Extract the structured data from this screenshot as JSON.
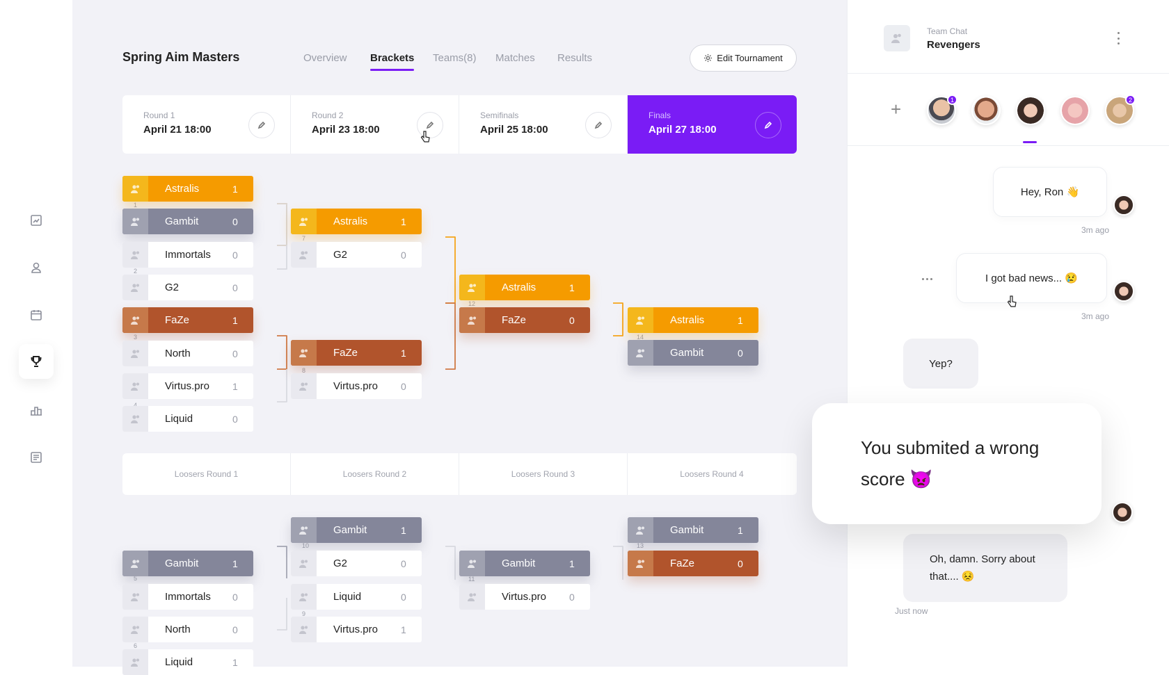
{
  "nav": {
    "items": [
      "stats",
      "profile",
      "calendar",
      "tournaments",
      "leaderboard",
      "reports"
    ],
    "active": "tournaments"
  },
  "header": {
    "title": "Spring Aim Masters",
    "tabs": [
      {
        "label": "Overview",
        "active": false
      },
      {
        "label": "Brackets",
        "active": true
      },
      {
        "label": "Teams(8)",
        "active": false
      },
      {
        "label": "Matches",
        "active": false
      },
      {
        "label": "Results",
        "active": false
      }
    ],
    "edit_button": "Edit Tournament"
  },
  "rounds": [
    {
      "label": "Round 1",
      "date": "April 21 18:00"
    },
    {
      "label": "Round 2",
      "date": "April 23 18:00"
    },
    {
      "label": "Semifinals",
      "date": "April 25 18:00"
    },
    {
      "label": "Finals",
      "date": "April 27 18:00"
    }
  ],
  "losers_rounds": [
    "Loosers Round 1",
    "Loosers Round 2",
    "Loosers Round 3",
    "Loosers Round 4"
  ],
  "bracket": {
    "r1": [
      {
        "team": "Astralis",
        "score": "1",
        "style": "orange"
      },
      {
        "team": "Gambit",
        "score": "0",
        "style": "grey"
      },
      {
        "team": "Immortals",
        "score": "0",
        "style": "white"
      },
      {
        "team": "G2",
        "score": "0",
        "style": "white"
      },
      {
        "team": "FaZe",
        "score": "1",
        "style": "brown"
      },
      {
        "team": "North",
        "score": "0",
        "style": "white"
      },
      {
        "team": "Virtus.pro",
        "score": "1",
        "style": "white"
      },
      {
        "team": "Liquid",
        "score": "0",
        "style": "white"
      }
    ],
    "r2": [
      {
        "team": "Astralis",
        "score": "1",
        "style": "orange"
      },
      {
        "team": "G2",
        "score": "0",
        "style": "white"
      },
      {
        "team": "FaZe",
        "score": "1",
        "style": "brown"
      },
      {
        "team": "Virtus.pro",
        "score": "0",
        "style": "white"
      }
    ],
    "semi": [
      {
        "team": "Astralis",
        "score": "1",
        "style": "orange"
      },
      {
        "team": "FaZe",
        "score": "0",
        "style": "brown"
      }
    ],
    "final": [
      {
        "team": "Astralis",
        "score": "1",
        "style": "orange"
      },
      {
        "team": "Gambit",
        "score": "0",
        "style": "grey"
      }
    ],
    "l1": [
      {
        "team": "Gambit",
        "score": "1",
        "style": "grey"
      },
      {
        "team": "Immortals",
        "score": "0",
        "style": "white"
      },
      {
        "team": "North",
        "score": "0",
        "style": "white"
      },
      {
        "team": "Liquid",
        "score": "1",
        "style": "white"
      }
    ],
    "l2": [
      {
        "team": "Gambit",
        "score": "1",
        "style": "grey"
      },
      {
        "team": "G2",
        "score": "0",
        "style": "white"
      },
      {
        "team": "Liquid",
        "score": "0",
        "style": "white"
      },
      {
        "team": "Virtus.pro",
        "score": "1",
        "style": "white"
      }
    ],
    "l3": [
      {
        "team": "Gambit",
        "score": "1",
        "style": "grey"
      },
      {
        "team": "Virtus.pro",
        "score": "0",
        "style": "white"
      }
    ],
    "l4": [
      {
        "team": "Gambit",
        "score": "1",
        "style": "grey"
      },
      {
        "team": "FaZe",
        "score": "0",
        "style": "brown"
      }
    ],
    "match_numbers": [
      "1",
      "2",
      "3",
      "4",
      "7",
      "8",
      "12",
      "14",
      "5",
      "6",
      "10",
      "9",
      "11",
      "13"
    ]
  },
  "chat": {
    "subtitle": "Team Chat",
    "team": "Revengers",
    "members": [
      {
        "name": "member-1",
        "badge": "1"
      },
      {
        "name": "member-2",
        "badge": ""
      },
      {
        "name": "member-3",
        "badge": ""
      },
      {
        "name": "member-4",
        "badge": ""
      },
      {
        "name": "member-5",
        "badge": "2"
      }
    ],
    "messages": [
      {
        "text": "Hey, Ron 👋",
        "time": "3m ago"
      },
      {
        "text": "I got bad news... 😢",
        "time": "3m ago"
      },
      {
        "text": "Yep?"
      },
      {
        "text": "You submited a wrong score 👿"
      },
      {
        "text": "Oh, damn. Sorry about that.... 😣",
        "time": "Just now"
      }
    ]
  },
  "colors": {
    "accent": "#7a1cf5",
    "orange": "#f59b00",
    "grey": "#84869a",
    "brown": "#b1542c"
  }
}
